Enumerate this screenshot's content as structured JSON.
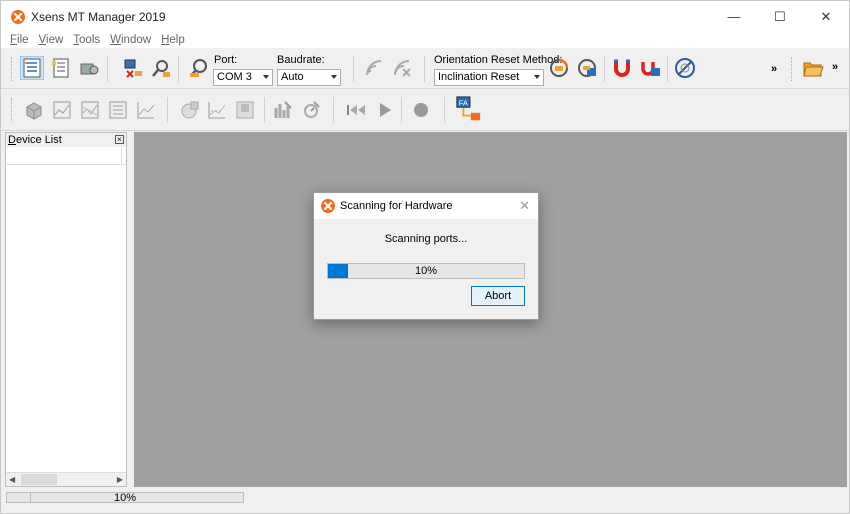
{
  "window": {
    "title": "Xsens MT Manager 2019",
    "controls": {
      "minimize": "—",
      "maximize": "☐",
      "close": "✕"
    }
  },
  "menu": [
    {
      "underline": "F",
      "rest": "ile"
    },
    {
      "underline": "V",
      "rest": "iew"
    },
    {
      "underline": "T",
      "rest": "ools"
    },
    {
      "underline": "W",
      "rest": "indow"
    },
    {
      "underline": "H",
      "rest": "elp"
    }
  ],
  "toolbar": {
    "port_label": "Port:",
    "port_value": "COM 3",
    "baudrate_label": "Baudrate:",
    "baudrate_value": "Auto",
    "orientation_label": "Orientation Reset Method:",
    "orientation_value": "Inclination Reset",
    "overflow": "»",
    "overflow2": "»"
  },
  "device_list": {
    "title": "Device List",
    "title_underline": "D",
    "title_rest": "evice List"
  },
  "dialog": {
    "title": "Scanning for Hardware",
    "message": "Scanning ports...",
    "progress": 0.1,
    "progress_text": "10%",
    "abort_label": "Abort"
  },
  "status": {
    "progress_text": "10%",
    "progress": 0.1
  },
  "colors": {
    "accent": "#0078d7",
    "brand": "#f26b1d",
    "mdi_background": "#a0a0a0"
  }
}
